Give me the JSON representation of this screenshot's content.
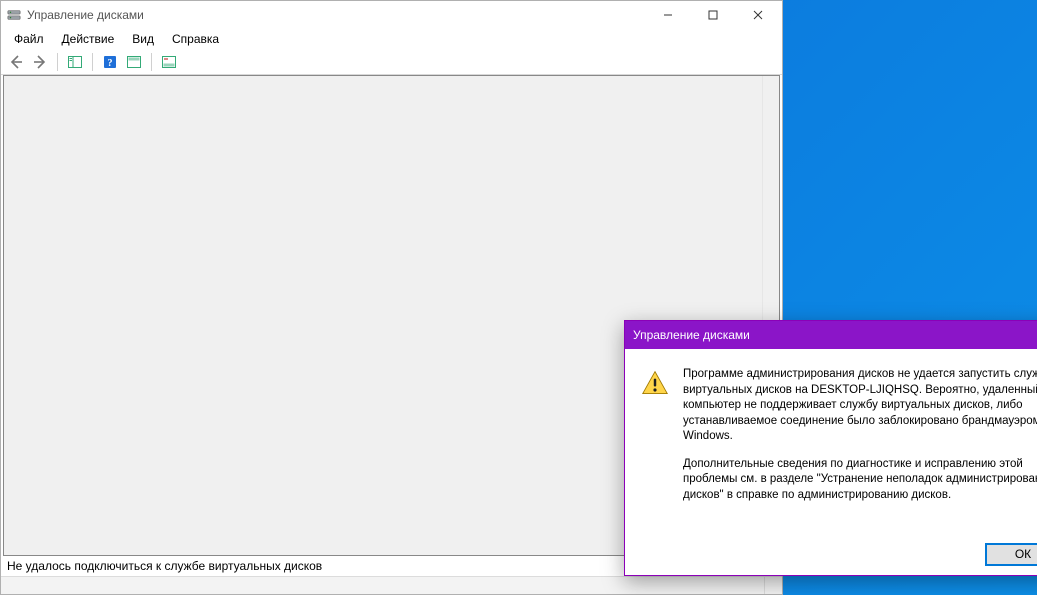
{
  "main_window": {
    "title": "Управление дисками",
    "menu": {
      "file": "Файл",
      "action": "Действие",
      "view": "Вид",
      "help": "Справка"
    },
    "status_text": "Не удалось подключиться к службе виртуальных дисков"
  },
  "dialog": {
    "title": "Управление дисками",
    "paragraph1": "Программе администрирования дисков не удается запустить службу виртуальных дисков на DESKTOP-LJIQHSQ. Вероятно, удаленный компьютер не поддерживает службу виртуальных дисков, либо устанавливаемое соединение было заблокировано брандмауэром Windows.",
    "paragraph2": "Дополнительные сведения по диагностике и исправлению этой проблемы см. в разделе \"Устранение неполадок администрирования дисков\" в справке по администрированию дисков.",
    "ok_label": "ОК"
  }
}
